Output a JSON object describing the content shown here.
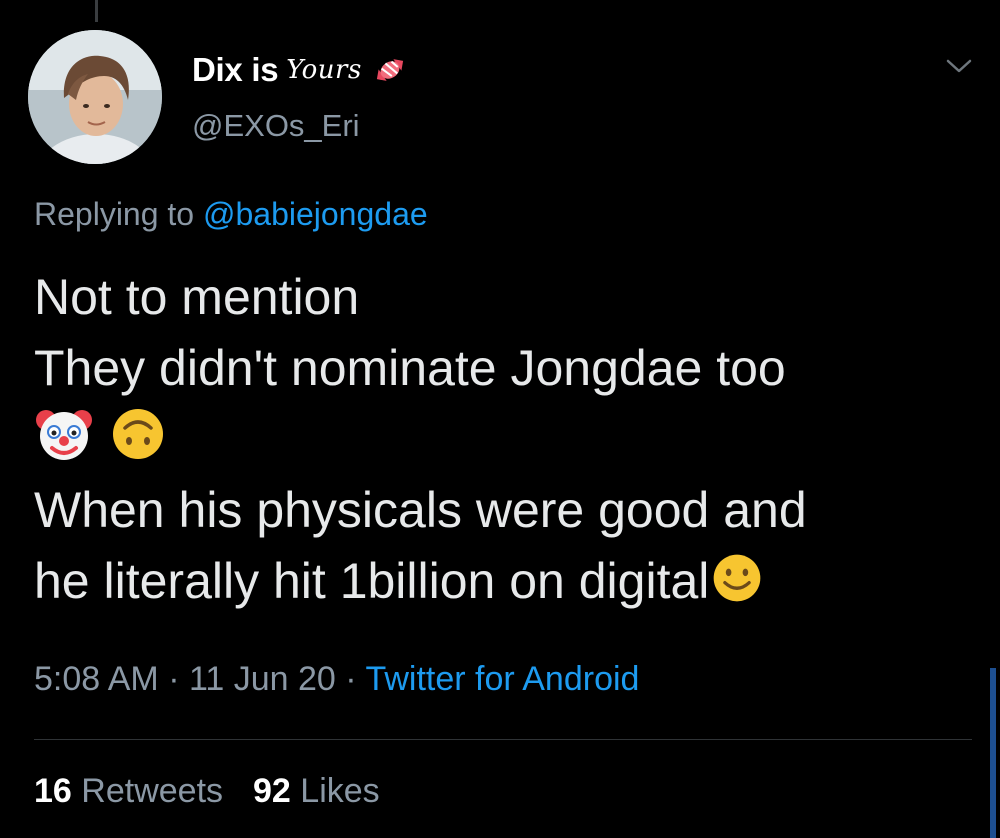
{
  "tweet": {
    "author": {
      "display_name": "Dix is",
      "display_name_suffix": "Yours",
      "handle": "@EXOs_Eri"
    },
    "replying": {
      "prefix": "Replying to",
      "mention": "@babiejongdae"
    },
    "body": {
      "line1": "Not to mention",
      "line2": "They didn't nominate Jongdae too",
      "line4": "When his physicals were good and",
      "line5": "he literally hit 1billion on digital"
    },
    "meta": {
      "time": "5:08 AM",
      "separator": "·",
      "date": "11 Jun 20",
      "source": "Twitter for Android"
    },
    "stats": {
      "retweets_count": "16",
      "retweets_label": "Retweets",
      "likes_count": "92",
      "likes_label": "Likes"
    }
  },
  "icons": {
    "menu": "chevron-down-icon",
    "name_decoration": "candy-icon"
  },
  "colors": {
    "background": "#000000",
    "accent": "#1d9bf0",
    "secondary_text": "#8b98a5"
  }
}
